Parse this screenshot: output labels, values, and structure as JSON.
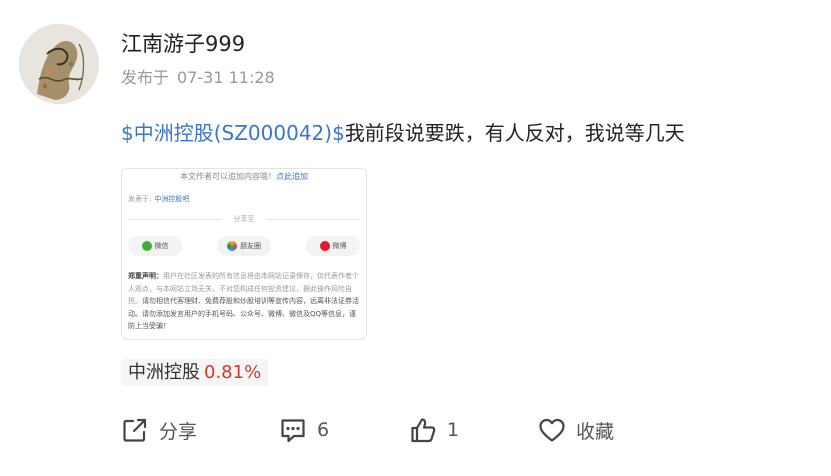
{
  "author": {
    "name": "江南游子999",
    "post_prefix": "发布于",
    "post_time": "07-31 11:28"
  },
  "post": {
    "stock_link": "$中洲控股(SZ000042)$",
    "text": "我前段说要跌，有人反对，我说等几天"
  },
  "card": {
    "notice_text": "本文作者可以追加内容哦！",
    "notice_link": "点此追加",
    "from_label": "发表于:",
    "from_bar": "中洲控股吧",
    "share_label": "分享至",
    "share_wechat": "微信",
    "share_moments": "朋友圈",
    "share_weibo": "微博",
    "disclaimer_title": "郑重声明：",
    "disclaimer_body": "用户在社区发表的所有信息将由本网站记录保存，仅代表作者个人观点，与本网站立场无关，不对您构成任何投资建议，据此操作风险自担。",
    "disclaimer_warning": "请勿相信代客理财、免费荐股和炒股培训等宣传内容，远离非法证券活动。请勿添加发言用户的手机号码、公众号、微博、微信及QQ等信息，谨防上当受骗！"
  },
  "stock_tag": {
    "name": "中洲控股",
    "change": "0.81%"
  },
  "actions": {
    "share_label": "分享",
    "comment_count": "6",
    "like_count": "1",
    "favorite_label": "收藏"
  },
  "colors": {
    "link": "#3a76c9",
    "up": "#d03a2b",
    "muted": "#999999"
  }
}
